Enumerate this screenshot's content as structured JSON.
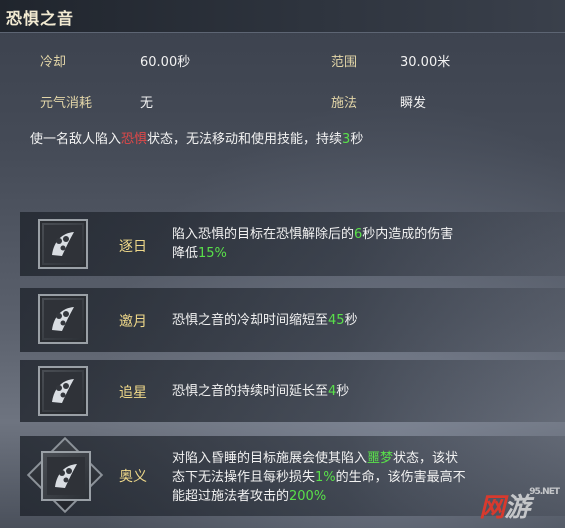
{
  "title": "恐惧之音",
  "stats": {
    "cooldown_label": "冷却",
    "cooldown_value": "60.00秒",
    "range_label": "范围",
    "range_value": "30.00米",
    "cost_label": "元气消耗",
    "cost_value": "无",
    "cast_label": "施法",
    "cast_value": "瞬发"
  },
  "description": {
    "p1": "使一名敌人陷入",
    "h1": "恐惧",
    "p2": "状态，无法移动和使用技能，持续",
    "h2": "3",
    "p3": "秒"
  },
  "talents": [
    {
      "name": "逐日",
      "line1a": "陷入恐惧的目标在恐惧解除后的",
      "line1b": "6",
      "line1c": "秒内造成的伤害",
      "line2a": "降低",
      "line2b": "15%"
    },
    {
      "name": "邀月",
      "a": "恐惧之音的冷却时间缩短至",
      "b": "45",
      "c": "秒"
    },
    {
      "name": "追星",
      "a": "恐惧之音的持续时间延长至",
      "b": "4",
      "c": "秒"
    },
    {
      "name": "奥义",
      "l1a": "对陷入昏睡的目标施展会使其陷入",
      "l1b": "噩梦",
      "l1c": "状态，该状",
      "l2a": "态下无法操作且每秒损失",
      "l2b": "1%",
      "l2c": "的生命，该伤害最高不",
      "l3a": "能超过施法者攻击的",
      "l3b": "200%"
    }
  ],
  "watermark": {
    "part1": "网",
    "part2": "游",
    "small": "95.NET"
  },
  "colors": {
    "highlight_red": "#e04848",
    "highlight_green": "#59e04a",
    "talent_name": "#f0d98a"
  }
}
